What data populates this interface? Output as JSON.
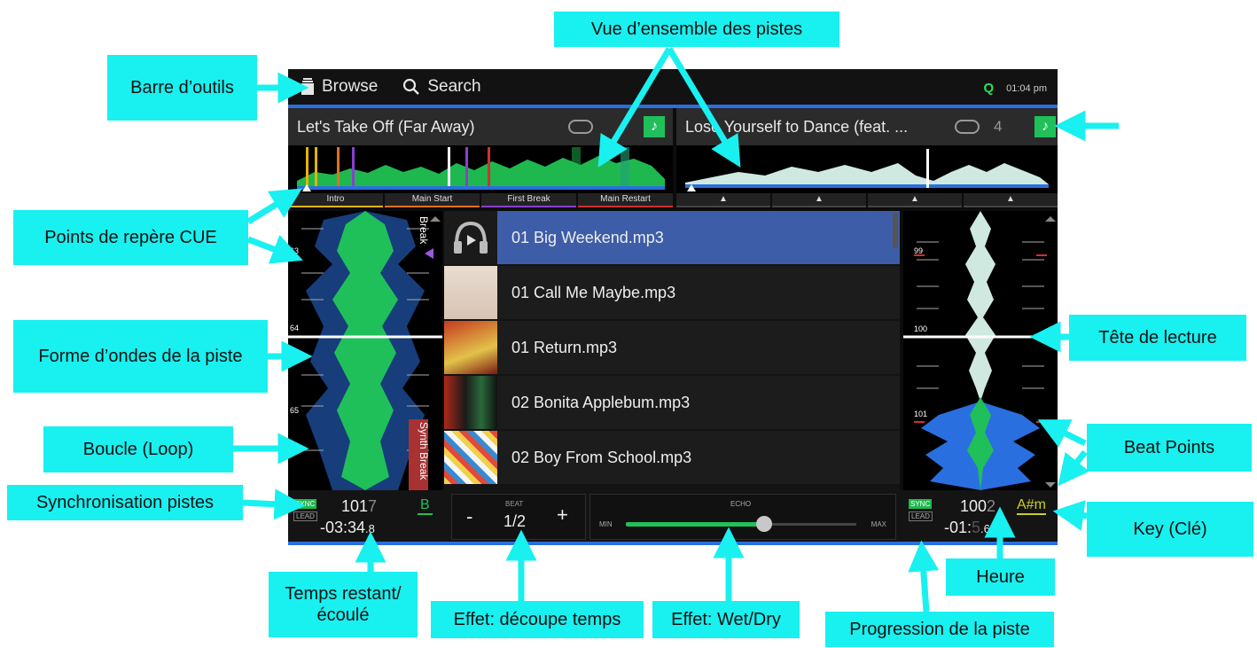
{
  "callouts": {
    "barre_outils": "Barre d’outils",
    "vue_ensemble": "Vue d’ensemble des pistes",
    "points_cue": "Points de repère CUE",
    "forme_ondes": "Forme d’ondes de la piste",
    "boucle": "Boucle (Loop)",
    "synchronisation": "Synchronisation pistes",
    "temps": "Temps restant/ écoulé",
    "effet_decoupe": "Effet: découpe temps",
    "effet_wetdry": "Effet: Wet/Dry",
    "progression": "Progression de la piste",
    "heure": "Heure",
    "key": "Key (Clé)",
    "beat_points": "Beat Points",
    "tete_lecture": "Tête de lecture"
  },
  "toolbar": {
    "browse_label": "Browse",
    "search_label": "Search",
    "quantize_label": "Q",
    "clock": "01:04 pm"
  },
  "deck_left": {
    "title": "Let's Take Off (Far Away)",
    "cue_labels": [
      "Intro",
      "Main Start",
      "First Break",
      "Main Restart"
    ],
    "cue_colors": [
      "#e6b400",
      "#e07020",
      "#8a3fd0",
      "#d03030"
    ],
    "beat_markers": [
      "63",
      "64",
      "65"
    ],
    "loop_labels": [
      "Break",
      "Synth Break"
    ],
    "sync_label": "SYNC",
    "lead_label": "LEAD",
    "bpm_main": "101",
    "bpm_dec": "7",
    "key": "B",
    "time_main": "-03:34",
    "time_dec": ".8"
  },
  "deck_right": {
    "title": "Lose Yourself to Dance (feat. ...",
    "loop_count": "4",
    "beat_markers": [
      "99",
      "100",
      "101"
    ],
    "sync_label": "SYNC",
    "lead_label": "LEAD",
    "bpm_main": "100",
    "bpm_dec": "2",
    "key": "A#m",
    "time_main": "-01:",
    "time_dec": ".6",
    "time_hidden": "5"
  },
  "browser": {
    "tracks": [
      {
        "name": "01 Big Weekend.mp3",
        "selected": true
      },
      {
        "name": "01 Call Me Maybe.mp3",
        "selected": false
      },
      {
        "name": "01 Return.mp3",
        "selected": false
      },
      {
        "name": "02 Bonita Applebum.mp3",
        "selected": false
      },
      {
        "name": "02 Boy From School.mp3",
        "selected": false
      }
    ]
  },
  "fx": {
    "beat_label": "BEAT",
    "beat_value": "1/2",
    "minus": "-",
    "plus": "+",
    "echo_label": "ECHO",
    "min_label": "MIN",
    "max_label": "MAX",
    "wet_dry_level": 0.6
  },
  "colors": {
    "callout_bg": "#19f0f0",
    "accent_blue": "#2a6fe0",
    "green": "#1fc05a"
  }
}
